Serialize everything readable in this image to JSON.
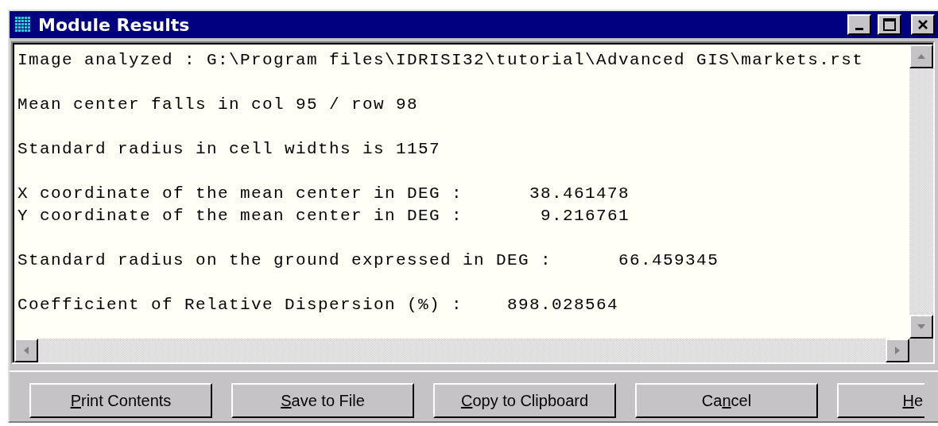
{
  "window": {
    "title": "Module Results"
  },
  "output": {
    "paragraphs": [
      [
        "Image analyzed : G:\\Program files\\IDRISI32\\tutorial\\Advanced GIS\\markets.rst"
      ],
      [
        "Mean center falls in col 95 / row 98"
      ],
      [
        "Standard radius in cell widths is 1157"
      ],
      [
        "X coordinate of the mean center in DEG :      38.461478",
        "Y coordinate of the mean center in DEG :       9.216761"
      ],
      [
        "Standard radius on the ground expressed in DEG :      66.459345"
      ],
      [
        "Coefficient of Relative Dispersion (%) :    898.028564"
      ]
    ]
  },
  "buttons": [
    {
      "key": "P",
      "post": "rint Contents",
      "clipped": false
    },
    {
      "key": "S",
      "post": "ave to File",
      "clipped": false
    },
    {
      "key": "C",
      "post": "opy to Clipboard",
      "clipped": false
    },
    {
      "pre": "Ca",
      "key": "n",
      "post": "cel",
      "clipped": false
    },
    {
      "key": "H",
      "post": "e",
      "clipped": true
    }
  ]
}
